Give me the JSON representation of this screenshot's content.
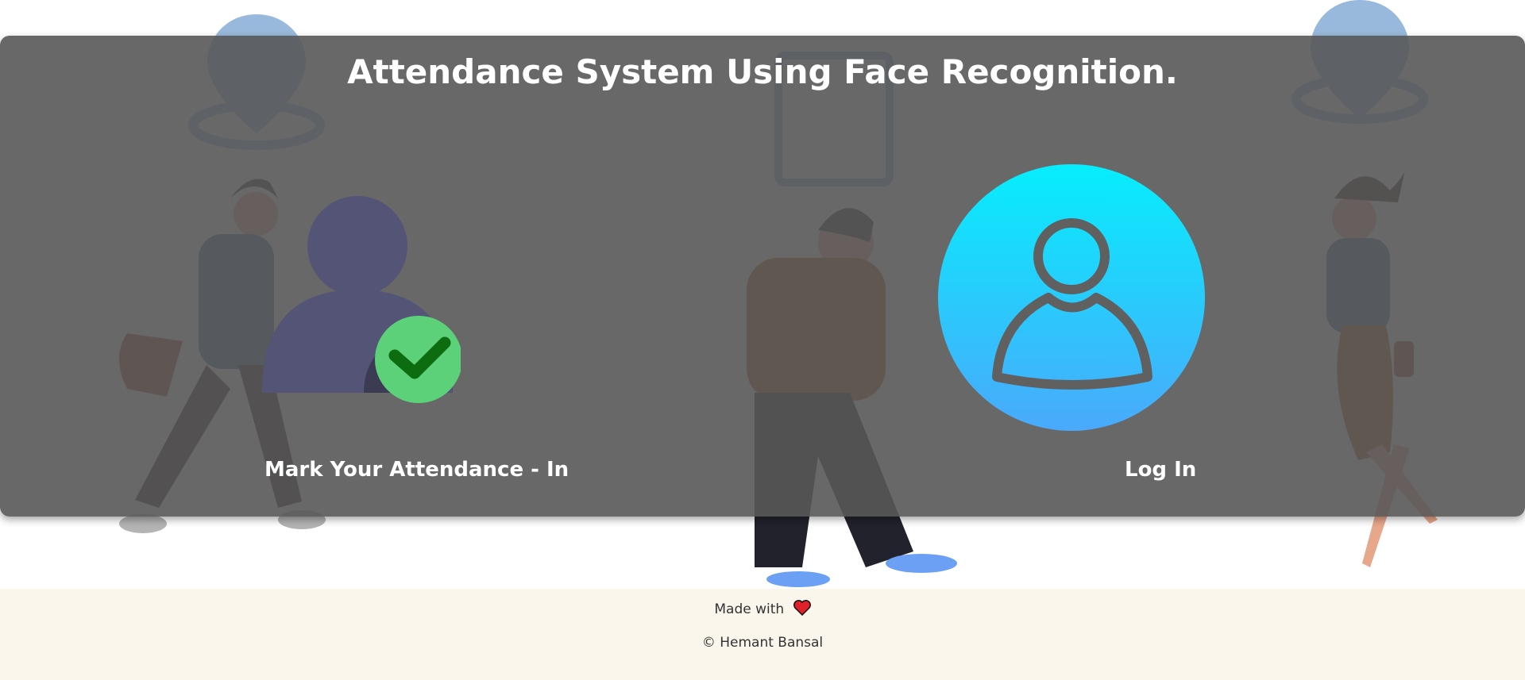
{
  "header": {
    "title": "Attendance System Using Face Recognition."
  },
  "actions": {
    "mark_in_label": "Mark Your Attendance - In",
    "login_label": "Log In"
  },
  "footer": {
    "made_with": "Made with",
    "copyright": "© Hemant Bansal"
  },
  "icons": {
    "mark_in": "user-check-icon",
    "login": "user-circle-icon",
    "heart": "heart-icon"
  },
  "colors": {
    "panel": "#585858",
    "check_green": "#5cd17a",
    "login_gradient_top": "#06eefd",
    "login_gradient_bottom": "#4aa9fb",
    "footer_bg": "#fbf6ec"
  }
}
